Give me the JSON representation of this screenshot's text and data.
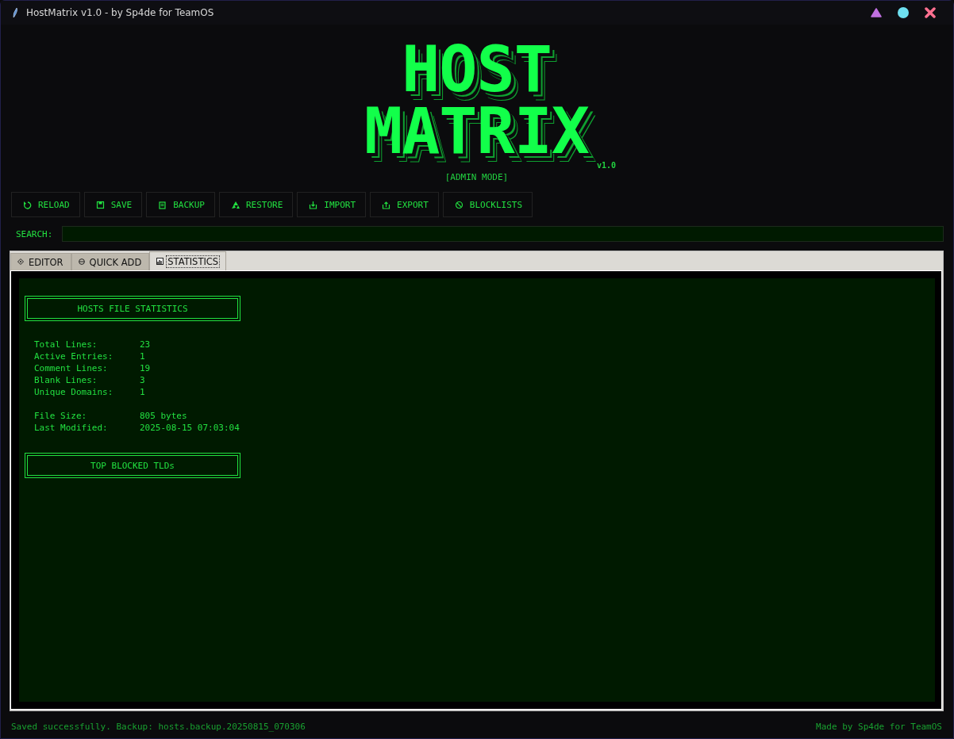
{
  "window": {
    "title": "HostMatrix v1.0 - by Sp4de for TeamOS"
  },
  "logo": {
    "lines": [
      "HOST",
      "MATRIX"
    ],
    "version": "v1.0",
    "mode": "[ADMIN MODE]"
  },
  "toolbar": [
    "RELOAD",
    "SAVE",
    "BACKUP",
    "RESTORE",
    "IMPORT",
    "EXPORT",
    "BLOCKLISTS"
  ],
  "search": {
    "label": "SEARCH:"
  },
  "tabs": [
    {
      "label": "EDITOR",
      "selected": false
    },
    {
      "label": "QUICK ADD",
      "selected": false
    },
    {
      "label": "STATISTICS",
      "selected": true
    }
  ],
  "statistics": {
    "sections": [
      {
        "heading": "HOSTS FILE STATISTICS",
        "groups": [
          [
            {
              "label": "Total Lines:",
              "value": "23"
            },
            {
              "label": "Active Entries:",
              "value": "1"
            },
            {
              "label": "Comment Lines:",
              "value": "19"
            },
            {
              "label": "Blank Lines:",
              "value": "3"
            },
            {
              "label": "Unique Domains:",
              "value": "1"
            }
          ],
          [
            {
              "label": "File Size:",
              "value": "805 bytes"
            },
            {
              "label": "Last Modified:",
              "value": "2025-08-15 07:03:04"
            }
          ]
        ]
      },
      {
        "heading": "TOP BLOCKED TLDs"
      }
    ]
  },
  "status_bar": {
    "message": "Saved successfully. Backup: hosts.backup.20250815_070306",
    "credit": "Made by Sp4de for TeamOS"
  }
}
